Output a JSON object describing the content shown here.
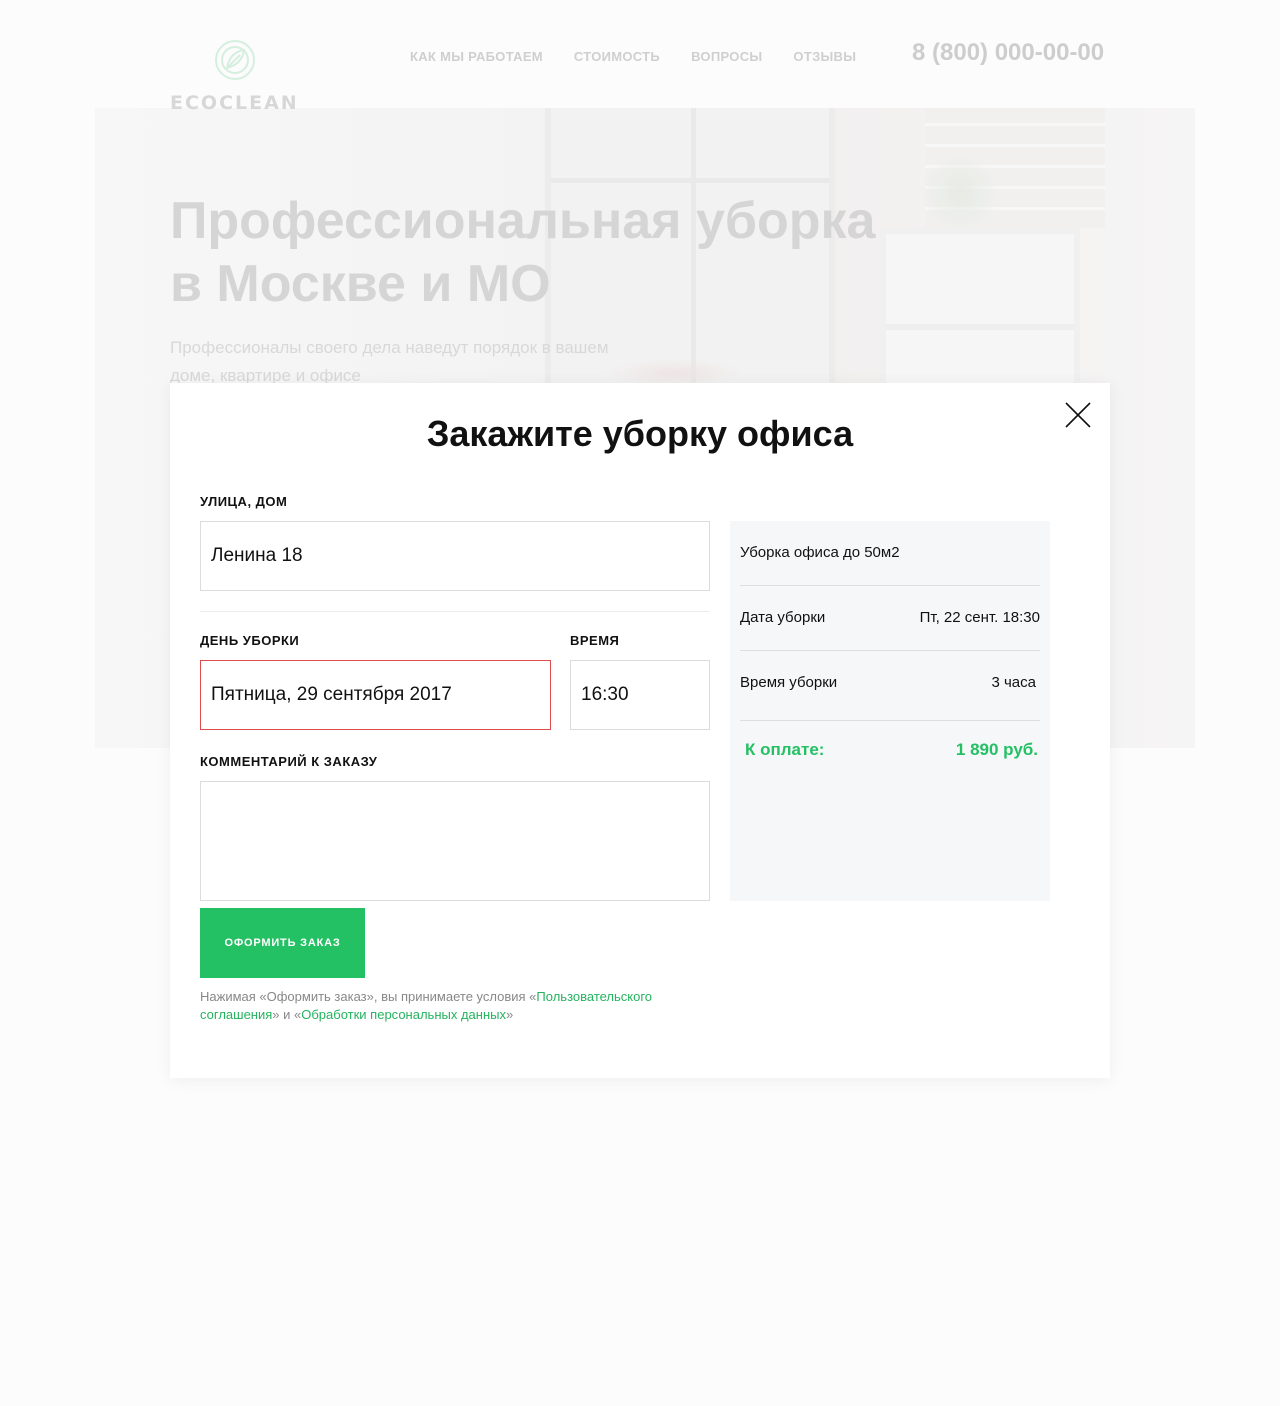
{
  "header": {
    "logo_text": "ECOCLEAN",
    "nav": [
      {
        "label": "КАК МЫ РАБОТАЕМ"
      },
      {
        "label": "СТОИМОСТЬ"
      },
      {
        "label": "ВОПРОСЫ"
      },
      {
        "label": "ОТЗЫВЫ"
      }
    ],
    "phone": "8 (800) 000-00-00"
  },
  "hero": {
    "title_line1": "Профессиональная уборка",
    "title_line2": "в Москве и МО",
    "subtitle": "Профессионалы своего дела наведут порядок в вашем доме, квартире и офисе"
  },
  "modal": {
    "title": "Закажите уборку офиса",
    "street_label": "УЛИЦА, ДОМ",
    "street_value": "Ленина 18",
    "day_label": "ДЕНЬ УБОРКИ",
    "day_value": "Пятница, 29 сентября 2017",
    "time_label": "ВРЕМЯ",
    "time_value": "16:30",
    "comment_label": "КОММЕНТАРИЙ К ЗАКАЗУ",
    "comment_value": "",
    "submit_label": "ОФОРМИТЬ ЗАКАЗ",
    "terms_prefix": "Нажимая «Оформить заказ», вы принимаете условия «",
    "terms_link1": "Пользовательского соглашения",
    "terms_middle": "» и «",
    "terms_link2": "Обработки персональных данных",
    "terms_suffix": "»"
  },
  "summary": {
    "service": "Уборка офиса до 50м2",
    "date_label": "Дата уборки",
    "date_value": "Пт, 22 сент. 18:30",
    "duration_label": "Время уборки",
    "duration_value": "3 часа",
    "total_label": "К оплате:",
    "total_value": "1 890 руб."
  },
  "colors": {
    "accent": "#24c064",
    "error_border": "#e04b4b",
    "summary_bg": "#f6f7f9"
  },
  "icons": {
    "logo": "leaf-circle-icon",
    "close": "close-icon"
  }
}
